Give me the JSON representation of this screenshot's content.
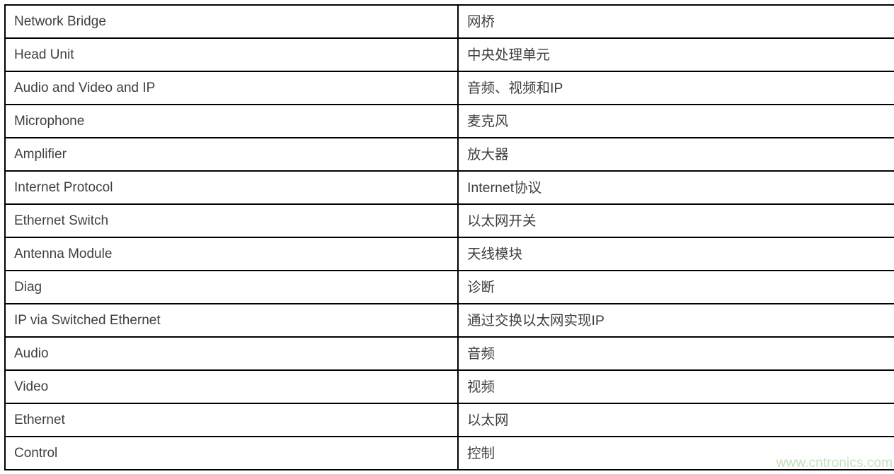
{
  "table": {
    "columns": [
      "term",
      "translation"
    ],
    "rows": [
      {
        "term": "Network Bridge",
        "translation": "网桥"
      },
      {
        "term": "Head Unit",
        "translation": "中央处理单元"
      },
      {
        "term": "Audio and Video and IP",
        "translation": "音频、视频和IP"
      },
      {
        "term": "Microphone",
        "translation": "麦克风"
      },
      {
        "term": "Amplifier",
        "translation": "放大器"
      },
      {
        "term": "Internet Protocol",
        "translation": "Internet协议"
      },
      {
        "term": "Ethernet Switch",
        "translation": "以太网开关"
      },
      {
        "term": "Antenna Module",
        "translation": "天线模块"
      },
      {
        "term": "Diag",
        "translation": "诊断"
      },
      {
        "term": "IP via Switched Ethernet",
        "translation": "通过交换以太网实现IP"
      },
      {
        "term": "Audio",
        "translation": "音频"
      },
      {
        "term": "Video",
        "translation": "视频"
      },
      {
        "term": "Ethernet",
        "translation": "以太网"
      },
      {
        "term": "Control",
        "translation": "控制"
      }
    ]
  },
  "watermark": {
    "text": "www.cntronics.com",
    "color": "#c6e1bb"
  },
  "colors": {
    "border": "#000000",
    "text": "#3f3f3f",
    "background": "#ffffff"
  }
}
